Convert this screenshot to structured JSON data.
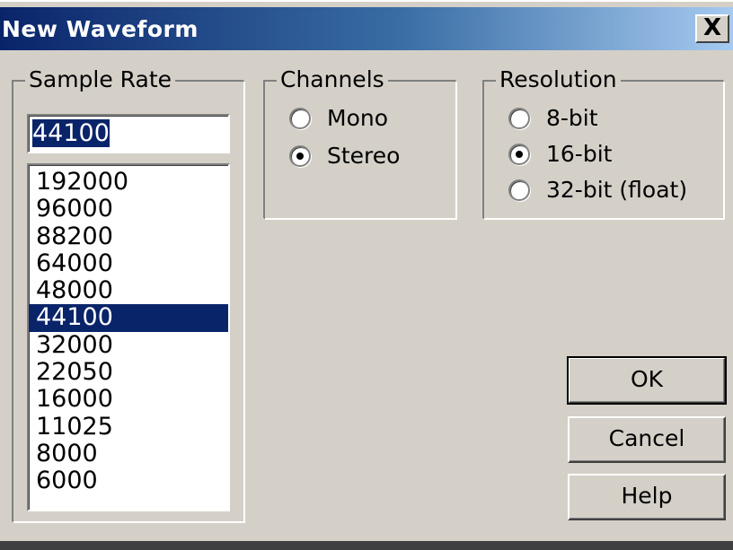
{
  "window": {
    "title": "New Waveform",
    "close_label": "X"
  },
  "sample_rate": {
    "legend": "Sample Rate",
    "input_value": "44100",
    "options": [
      "192000",
      "96000",
      "88200",
      "64000",
      "48000",
      "44100",
      "32000",
      "22050",
      "16000",
      "11025",
      "8000",
      "6000"
    ],
    "selected": "44100"
  },
  "channels": {
    "legend": "Channels",
    "options": [
      {
        "label": "Mono",
        "checked": false
      },
      {
        "label": "Stereo",
        "checked": true
      }
    ]
  },
  "resolution": {
    "legend": "Resolution",
    "options": [
      {
        "label": "8-bit",
        "checked": false
      },
      {
        "label": "16-bit",
        "checked": true
      },
      {
        "label": "32-bit (float)",
        "checked": false
      }
    ]
  },
  "buttons": {
    "ok": "OK",
    "cancel": "Cancel",
    "help": "Help"
  },
  "colors": {
    "face": "#d4d0c8",
    "selection": "#0a246a",
    "title_start": "#0a246a",
    "title_end": "#a6caf0"
  }
}
